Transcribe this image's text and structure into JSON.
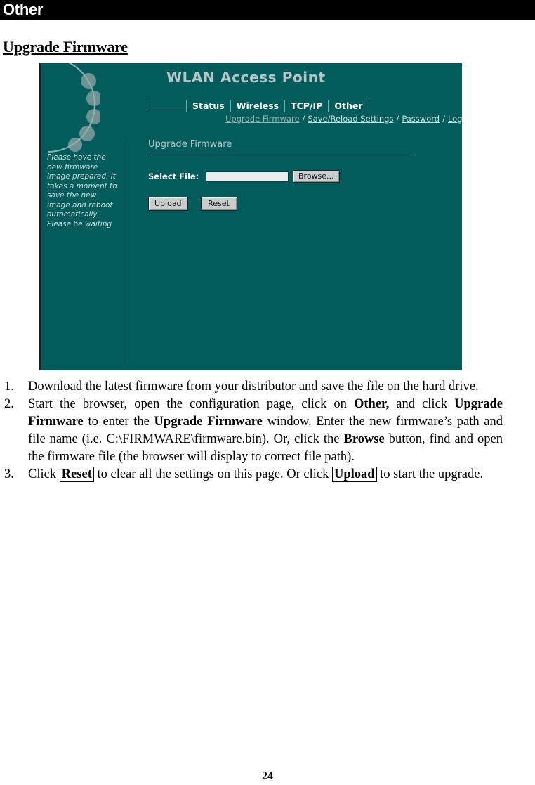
{
  "chapter": {
    "title": "Other"
  },
  "section": {
    "heading": "Upgrade Firmware"
  },
  "screenshot": {
    "app_title": "WLAN Access Point",
    "tabs": [
      {
        "label": "Status"
      },
      {
        "label": "Wireless"
      },
      {
        "label": "TCP/IP"
      },
      {
        "label": "Other"
      }
    ],
    "subnav": [
      {
        "label": "Upgrade Firmware",
        "current": true
      },
      {
        "label": "Save/Reload Settings",
        "current": false
      },
      {
        "label": "Password",
        "current": false
      },
      {
        "label": "Log",
        "current": false
      }
    ],
    "subnav_separator": "/",
    "side_note": "Please have the new firmware image prepared. It takes a moment to save the new image and reboot automatically. Please be waiting",
    "panel": {
      "title": "Upgrade Firmware",
      "field_label": "Select File:",
      "file_value": "",
      "file_placeholder": "",
      "browse_label": "Browse...",
      "upload_label": "Upload",
      "reset_label": "Reset"
    },
    "colors": {
      "background": "#035C5C",
      "title_text": "#b9c6c6",
      "link_text": "#cfdede",
      "button_face": "#c8cdcd",
      "input_face": "#e9ecec"
    }
  },
  "steps": [
    {
      "number": "1.",
      "parts": [
        {
          "text": "Download the latest firmware from your distributor and save the file on the hard drive.",
          "style": "normal"
        }
      ]
    },
    {
      "number": "2.",
      "parts": [
        {
          "text": "Start the browser, open the configuration page, click on ",
          "style": "normal"
        },
        {
          "text": "Other,",
          "style": "bold"
        },
        {
          "text": " and click ",
          "style": "normal"
        },
        {
          "text": "Upgrade Firmware",
          "style": "bold"
        },
        {
          "text": " to enter the ",
          "style": "normal"
        },
        {
          "text": "Upgrade Firmware",
          "style": "bold"
        },
        {
          "text": " window. Enter the new firmware’s path and file name (i.e. C:\\FIRMWARE\\firmware.bin). Or, click the ",
          "style": "normal"
        },
        {
          "text": "Browse",
          "style": "bold"
        },
        {
          "text": " button, find and open the firmware file (the browser will display to correct file path).",
          "style": "normal"
        }
      ]
    },
    {
      "number": "3.",
      "parts": [
        {
          "text": "Click ",
          "style": "normal"
        },
        {
          "text": "Reset",
          "style": "boxed"
        },
        {
          "text": " to clear all the settings on this page. Or click ",
          "style": "normal"
        },
        {
          "text": "Upload",
          "style": "boxed"
        },
        {
          "text": " to start the upgrade.",
          "style": "normal"
        }
      ]
    }
  ],
  "footer": {
    "page_number": "24"
  }
}
